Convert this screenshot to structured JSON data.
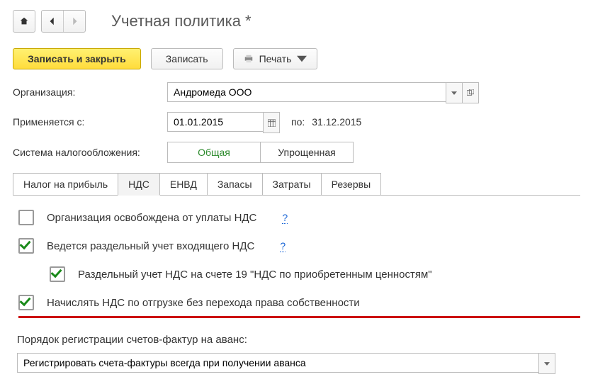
{
  "title": "Учетная политика *",
  "actions": {
    "save_close": "Записать и закрыть",
    "save": "Записать",
    "print": "Печать"
  },
  "fields": {
    "org_label": "Организация:",
    "org_value": "Андромеда ООО",
    "applies_label": "Применяется с:",
    "applies_value": "01.01.2015",
    "to_label": "по:",
    "to_value": "31.12.2015",
    "tax_sys_label": "Система налогообложения:",
    "tax_sys_general": "Общая",
    "tax_sys_simple": "Упрощенная"
  },
  "tabs": {
    "profit": "Налог на прибыль",
    "nds": "НДС",
    "envd": "ЕНВД",
    "stock": "Запасы",
    "costs": "Затраты",
    "reserves": "Резервы"
  },
  "nds": {
    "exempt": {
      "label": "Организация освобождена от уплаты НДС",
      "checked": false
    },
    "separate": {
      "label": "Ведется раздельный учет входящего НДС",
      "checked": true
    },
    "acct19": {
      "label": "Раздельный учет НДС на счете 19 \"НДС по приобретенным ценностям\"",
      "checked": true
    },
    "onship": {
      "label": "Начислять НДС по отгрузке без перехода права собственности",
      "checked": true
    },
    "invoice_label": "Порядок регистрации счетов-фактур на аванс:",
    "invoice_value": "Регистрировать счета-фактуры всегда при получении аванса",
    "help": "?"
  }
}
